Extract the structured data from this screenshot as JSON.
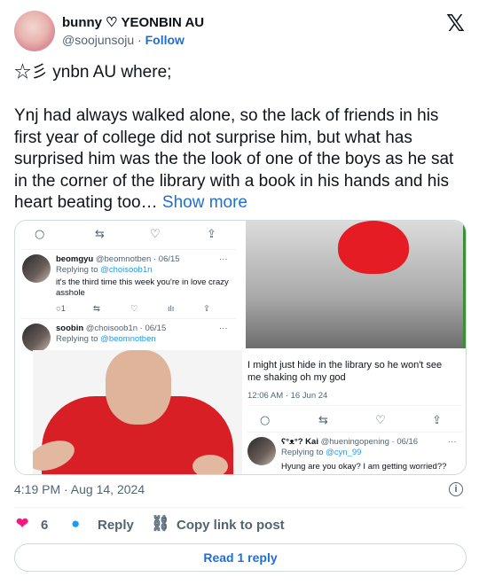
{
  "author": {
    "display_name": "bunny ♡ YEONBIN AU",
    "handle": "@soojunsoju",
    "separator": "·",
    "follow_label": "Follow"
  },
  "brand_icon": "x-logo",
  "tweet": {
    "line1": "☆彡 ynbn AU where;",
    "body": "Ynj had always walked alone, so the lack of friends in his first year of college did not surprise him, but what has surprised him was the the look of one of the boys as he sat in the corner of the library with a book in his hands and his heart beating too…",
    "show_more": "Show more"
  },
  "media_left": {
    "reply1": {
      "name": "beomgyu",
      "handle_date": "@beomnotben · 06/15",
      "replying_prefix": "Replying to",
      "replying_to": "@choisoob1n",
      "text": "it's the third time this week you're in love crazy asshole",
      "reply_count": "1",
      "more": "···"
    },
    "reply2": {
      "name": "soobin",
      "handle_date": "@choisoob1n · 06/15",
      "replying_prefix": "Replying to",
      "replying_to": "@beomnotben",
      "more": "···"
    }
  },
  "media_right": {
    "text": "I might just hide in the library so he won't see me shaking oh my god",
    "timestamp": "12:06 AM · 16 Jun 24",
    "reply": {
      "name": "Kai",
      "name_prefix": "ʕ°ᴥ°?",
      "handle_date": "@hueningopening · 06/16",
      "replying_prefix": "Replying to",
      "replying_to": "@cyn_99",
      "text": "Hyung are you okay? I am getting worried??",
      "more": "···"
    }
  },
  "meta": {
    "time": "4:19 PM · Aug 14, 2024",
    "info_icon": "i"
  },
  "actions": {
    "like_count": "6",
    "reply_label": "Reply",
    "copy_label": "Copy link to post",
    "read_reply_label": "Read 1 reply"
  },
  "colors": {
    "link": "#1d6fd8",
    "like": "#f91880",
    "reply_bubble": "#1d9bf0"
  }
}
